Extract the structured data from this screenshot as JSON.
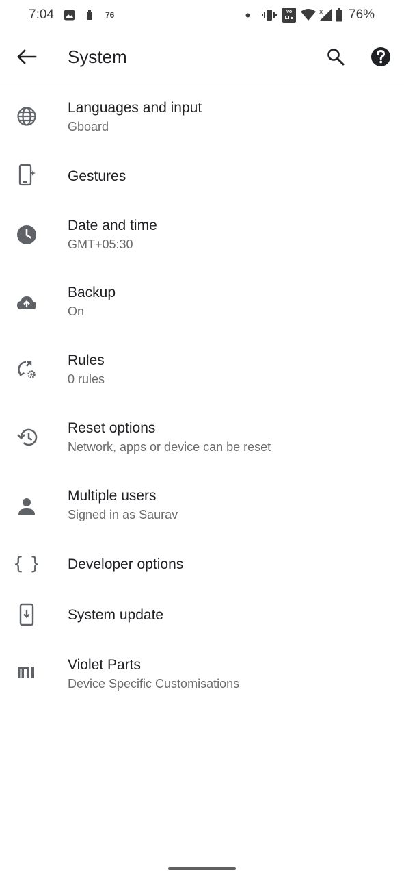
{
  "status_bar": {
    "time": "7:04",
    "notification_count": "76",
    "battery_percent": "76%",
    "volte_label": "Vo LTE",
    "icons": [
      "image-notification-icon",
      "clipboard-icon",
      "dot-icon",
      "vibrate-icon",
      "volte-icon",
      "wifi-icon",
      "signal-icon",
      "battery-icon"
    ]
  },
  "app_bar": {
    "title": "System",
    "back_icon": "arrow-back-icon",
    "search_icon": "search-icon",
    "help_icon": "help-icon"
  },
  "settings": [
    {
      "id": "languages",
      "icon": "globe-icon",
      "title": "Languages and input",
      "summary": "Gboard"
    },
    {
      "id": "gestures",
      "icon": "gesture-phone-icon",
      "title": "Gestures",
      "summary": ""
    },
    {
      "id": "date-time",
      "icon": "clock-icon",
      "title": "Date and time",
      "summary": "GMT+05:30"
    },
    {
      "id": "backup",
      "icon": "cloud-upload-icon",
      "title": "Backup",
      "summary": "On"
    },
    {
      "id": "rules",
      "icon": "rules-icon",
      "title": "Rules",
      "summary": "0 rules"
    },
    {
      "id": "reset",
      "icon": "history-icon",
      "title": "Reset options",
      "summary": "Network, apps or device can be reset"
    },
    {
      "id": "users",
      "icon": "person-icon",
      "title": "Multiple users",
      "summary": "Signed in as Saurav"
    },
    {
      "id": "developer",
      "icon": "braces-icon",
      "title": "Developer options",
      "summary": ""
    },
    {
      "id": "update",
      "icon": "system-update-icon",
      "title": "System update",
      "summary": ""
    },
    {
      "id": "violet",
      "icon": "mi-logo-icon",
      "title": "Violet Parts",
      "summary": "Device Specific Customisations"
    }
  ],
  "colors": {
    "icon": "#5f6368",
    "title_text": "#202124",
    "summary_text": "#6b6b6b",
    "divider": "#e4e4e4"
  }
}
